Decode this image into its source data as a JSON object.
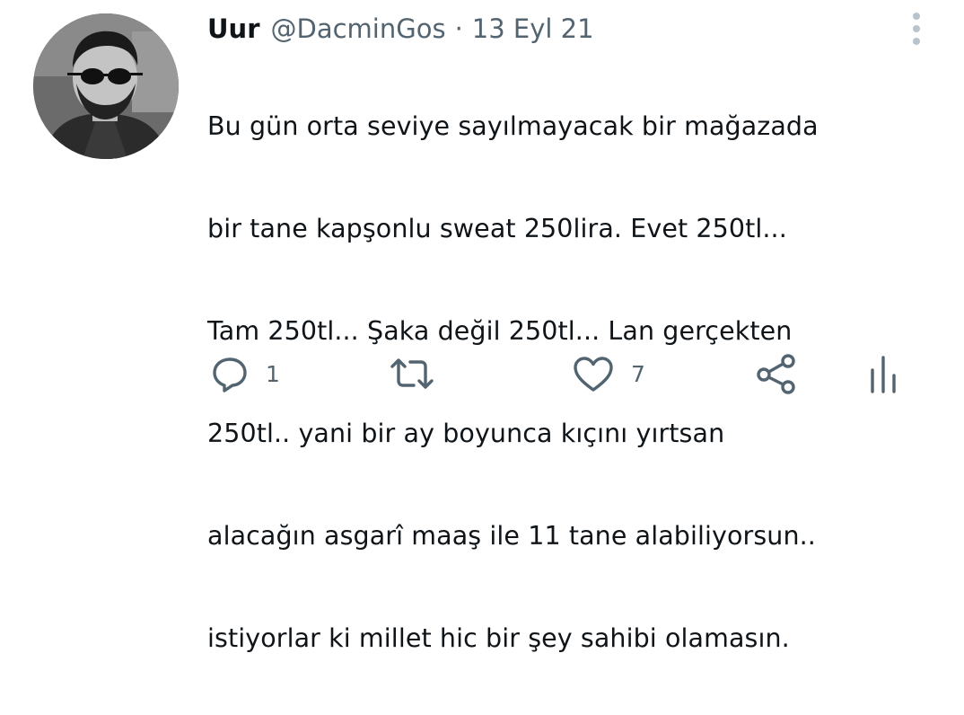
{
  "tweet": {
    "display_name": "Uur",
    "handle": "@DacminGos",
    "separator": "·",
    "date": "13 Eyl 21",
    "lines": [
      "Bu gün orta seviye sayılmayacak bir mağazada",
      "bir tane kapşonlu sweat 250lira. Evet 250tl...",
      "Tam 250tl... Şaka değil 250tl... Lan gerçekten",
      "250tl.. yani bir ay boyunca kıçını yırtsan",
      "alacağın asgarî maaş ile 11 tane alabiliyorsun..",
      "istiyorlar ki millet hic bir şey sahibi olamasın."
    ]
  },
  "actions": {
    "reply": {
      "icon": "reply-icon",
      "count": "1"
    },
    "retweet": {
      "icon": "retweet-icon",
      "count": ""
    },
    "like": {
      "icon": "heart-icon",
      "count": "7"
    },
    "share": {
      "icon": "share-icon"
    },
    "analytics": {
      "icon": "analytics-icon"
    }
  },
  "colors": {
    "text": "#0f1419",
    "secondary": "#536471",
    "more_dots": "#b9c3cb"
  }
}
